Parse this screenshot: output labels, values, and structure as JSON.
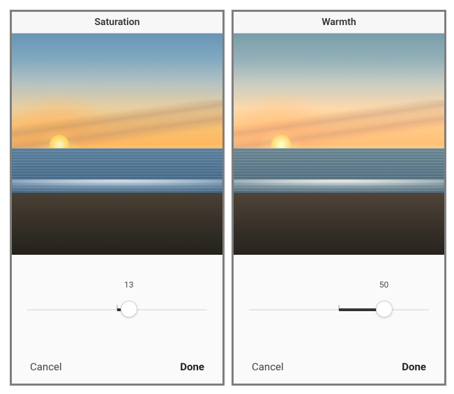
{
  "panels": [
    {
      "title": "Saturation",
      "slider": {
        "min": -100,
        "max": 100,
        "value": 13,
        "label": "13"
      },
      "cancel": "Cancel",
      "done": "Done"
    },
    {
      "title": "Warmth",
      "slider": {
        "min": -100,
        "max": 100,
        "value": 50,
        "label": "50"
      },
      "cancel": "Cancel",
      "done": "Done"
    }
  ]
}
